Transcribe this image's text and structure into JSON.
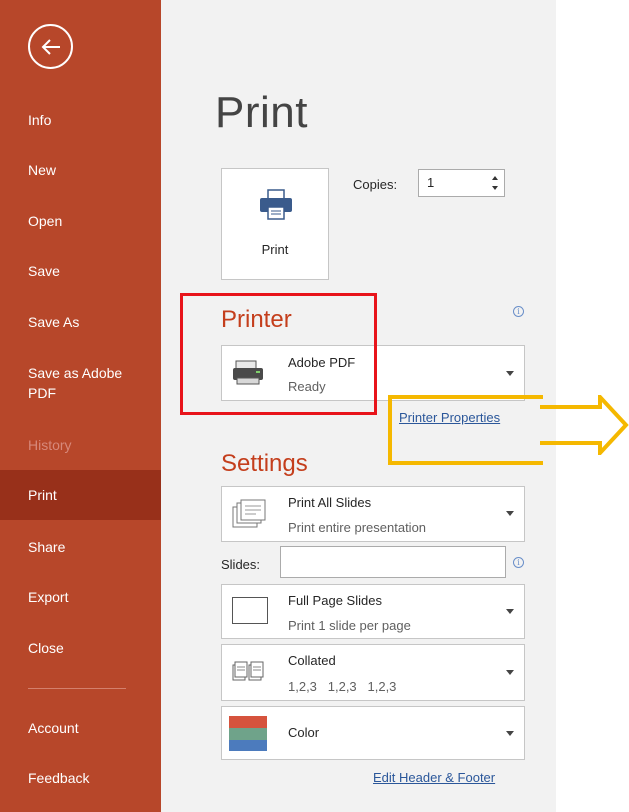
{
  "sidebar": {
    "items": [
      {
        "label": "Info",
        "state": "normal"
      },
      {
        "label": "New",
        "state": "normal"
      },
      {
        "label": "Open",
        "state": "normal"
      },
      {
        "label": "Save",
        "state": "normal"
      },
      {
        "label": "Save As",
        "state": "normal"
      },
      {
        "label": "Save as Adobe PDF",
        "state": "normal"
      },
      {
        "label": "History",
        "state": "disabled"
      },
      {
        "label": "Print",
        "state": "active"
      },
      {
        "label": "Share",
        "state": "normal"
      },
      {
        "label": "Export",
        "state": "normal"
      },
      {
        "label": "Close",
        "state": "normal"
      },
      {
        "label": "Account",
        "state": "normal"
      },
      {
        "label": "Feedback",
        "state": "normal"
      }
    ],
    "back_icon": "back-arrow-circle-icon"
  },
  "main": {
    "title": "Print",
    "print_button": {
      "label": "Print",
      "icon": "printer-icon"
    },
    "copies": {
      "label": "Copies:",
      "value": "1"
    },
    "printer": {
      "section_title": "Printer",
      "name": "Adobe PDF",
      "status": "Ready",
      "properties_link": "Printer Properties",
      "icon": "printer-device-icon"
    },
    "settings": {
      "section_title": "Settings",
      "range": {
        "title": "Print All Slides",
        "subtitle": "Print entire presentation"
      },
      "slides_label": "Slides:",
      "slides_value": "",
      "layout": {
        "title": "Full Page Slides",
        "subtitle": "Print 1 slide per page"
      },
      "collation": {
        "title": "Collated",
        "subtitle": "1,2,3   1,2,3   1,2,3"
      },
      "color": {
        "title": "Color"
      },
      "header_footer_link": "Edit Header & Footer"
    }
  },
  "colors": {
    "sidebar": "#b7472a",
    "sidebar_active": "#98301a",
    "accent": "#c43e1c",
    "link": "#2b579a",
    "highlight_red": "#e8141b",
    "highlight_yellow": "#f5b800"
  }
}
